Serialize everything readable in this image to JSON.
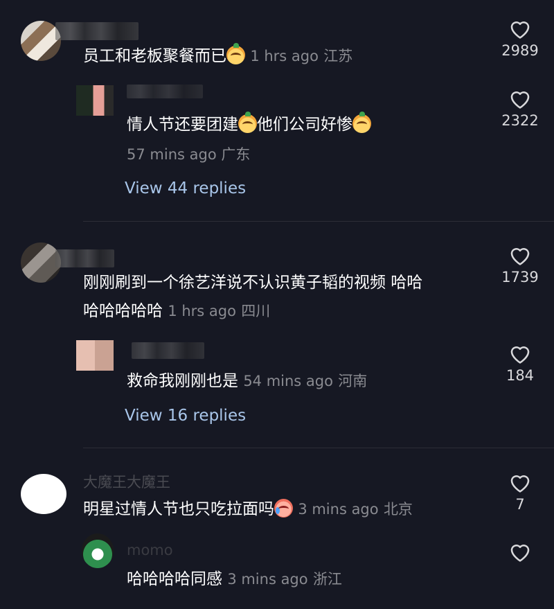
{
  "comments": [
    {
      "text": "员工和老板聚餐而已",
      "time": "1 hrs ago",
      "location": "江苏",
      "likes": "2989",
      "reply": {
        "text_a": "情人节还要团建",
        "text_b": "他们公司好惨",
        "time": "57 mins ago",
        "location": "广东",
        "likes": "2322"
      },
      "view_replies": "View 44 replies"
    },
    {
      "text_line1": "刚刚刷到一个徐艺洋说不认识黄子韬的视频 哈哈",
      "text_line2": "哈哈哈哈哈",
      "time": "1 hrs ago",
      "location": "四川",
      "likes": "1739",
      "reply": {
        "text": "救命我刚刚也是",
        "time": "54 mins ago",
        "location": "河南",
        "likes": "184"
      },
      "view_replies": "View 16 replies"
    },
    {
      "username": "大魔王大魔王",
      "text": "明星过情人节也只吃拉面吗",
      "time": "3 mins ago",
      "location": "北京",
      "likes": "7",
      "reply": {
        "username": "momo",
        "text": "哈哈哈哈同感",
        "time": "3 mins ago",
        "location": "浙江"
      }
    }
  ],
  "icons": {
    "like": "heart-outline-icon",
    "emoji_smile": "smiling-pear-emoji-icon",
    "emoji_cry": "crying-laughing-emoji-icon"
  },
  "colors": {
    "background": "#161823",
    "link": "#a9c6ea",
    "meta": "#8a8b91"
  }
}
